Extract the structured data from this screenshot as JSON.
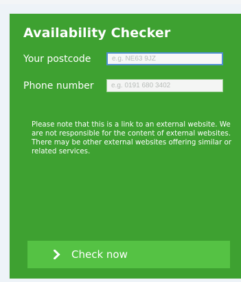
{
  "checker": {
    "title": "Availability Checker",
    "postcode": {
      "label": "Your postcode",
      "placeholder": "e.g. NE63 9JZ",
      "value": ""
    },
    "phone": {
      "label": "Phone number",
      "placeholder": "e.g. 0191 680 3402",
      "value": ""
    },
    "note": "Please note that this is a link to an external website. We are not responsible for the content of external websites. There may be other external websites offering similar or related services.",
    "button": {
      "label": "Check now",
      "icon": "chevron-right-icon"
    }
  },
  "colors": {
    "panel_green": "#3ea131",
    "button_green": "#55c244",
    "focus_blue": "#4f8fd1"
  }
}
